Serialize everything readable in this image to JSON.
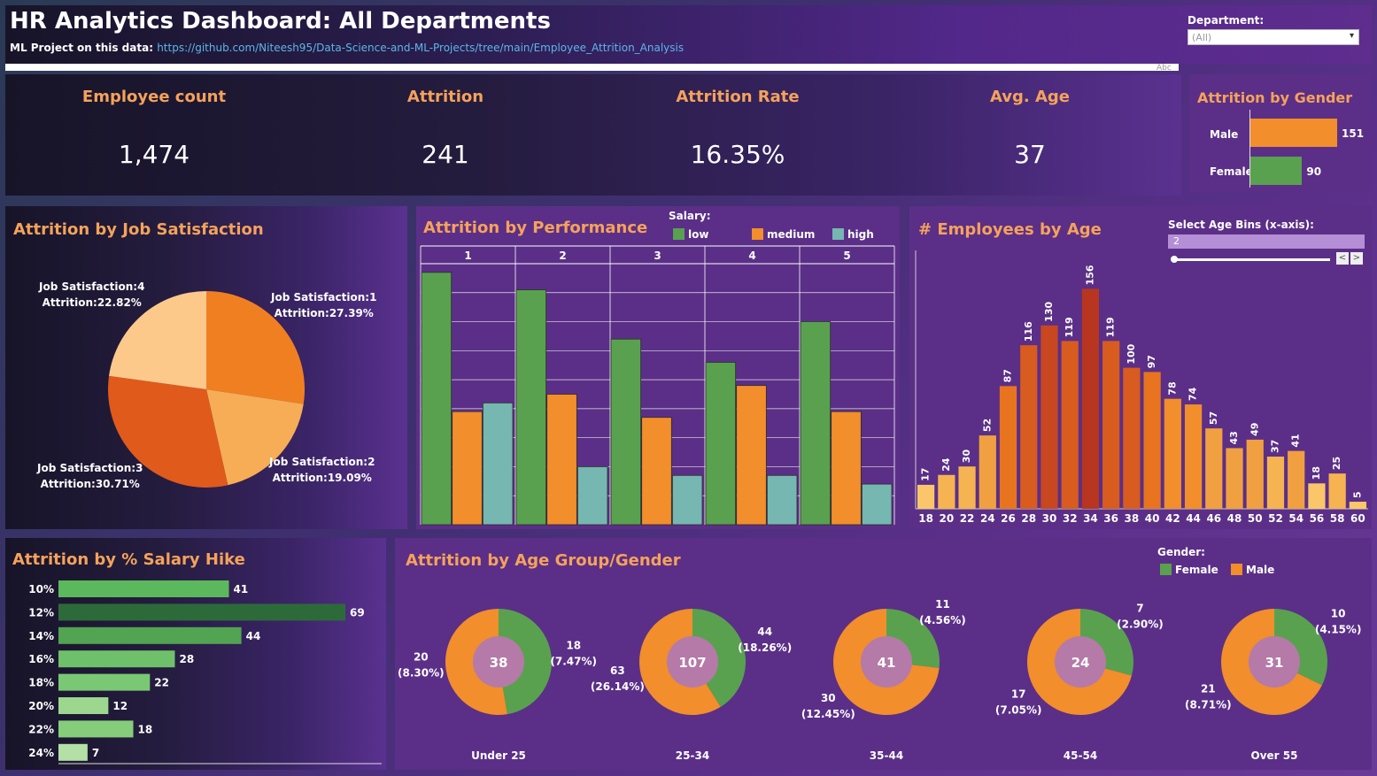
{
  "header": {
    "title": "HR Analytics Dashboard: All Departments",
    "ml_label": "ML Project on this data:",
    "ml_link": "https://github.com/Niteesh95/Data-Science-and-ML-Projects/tree/main/Employee_Attrition_Analysis",
    "department_label": "Department:",
    "department_value": "(All)",
    "abc": "Abc"
  },
  "kpis": {
    "employee_count_label": "Employee count",
    "employee_count": "1,474",
    "attrition_label": "Attrition",
    "attrition": "241",
    "attrition_rate_label": "Attrition Rate",
    "attrition_rate": "16.35%",
    "avg_age_label": "Avg. Age",
    "avg_age": "37"
  },
  "gender": {
    "title": "Attrition by Gender",
    "male_label": "Male",
    "male_value": "151",
    "female_label": "Female",
    "female_value": "90",
    "colors": {
      "male": "#f28e2b",
      "female": "#59a14f"
    }
  },
  "job_satisfaction": {
    "title": "Attrition by Job Satisfaction",
    "slices": [
      {
        "name": "Job Satisfaction:1",
        "attr": "Attrition:27.39%",
        "pct": 27.39,
        "color": "#f07f22"
      },
      {
        "name": "Job Satisfaction:2",
        "attr": "Attrition:19.09%",
        "pct": 19.09,
        "color": "#f6ad55"
      },
      {
        "name": "Job Satisfaction:3",
        "attr": "Attrition:30.71%",
        "pct": 30.71,
        "color": "#e05a1c"
      },
      {
        "name": "Job Satisfaction:4",
        "attr": "Attrition:22.82%",
        "pct": 22.82,
        "color": "#fdc98b"
      }
    ]
  },
  "performance": {
    "title": "Attrition by Performance",
    "legend_title": "Salary:",
    "legend": [
      {
        "name": "low",
        "color": "#59a14f"
      },
      {
        "name": "medium",
        "color": "#f28e2b"
      },
      {
        "name": "high",
        "color": "#76b7b2"
      }
    ],
    "columns": [
      "1",
      "2",
      "3",
      "4",
      "5"
    ]
  },
  "age": {
    "title": "# Employees by Age",
    "bins_label": "Select Age Bins (x-axis):",
    "bins_value": "2",
    "prev": "<",
    "next": ">",
    "ages": [
      "18",
      "20",
      "22",
      "24",
      "26",
      "28",
      "30",
      "32",
      "34",
      "36",
      "38",
      "40",
      "42",
      "44",
      "46",
      "48",
      "50",
      "52",
      "54",
      "56",
      "58",
      "60"
    ],
    "values": [
      17,
      24,
      30,
      52,
      87,
      116,
      130,
      119,
      156,
      119,
      100,
      97,
      78,
      74,
      57,
      43,
      49,
      37,
      41,
      18,
      25,
      5
    ]
  },
  "salary_hike": {
    "title": "Attrition by % Salary Hike",
    "rows": [
      {
        "label": "10%",
        "value": 41,
        "color": "#5cb85c"
      },
      {
        "label": "12%",
        "value": 69,
        "color": "#2d6a3a"
      },
      {
        "label": "14%",
        "value": 44,
        "color": "#52a352"
      },
      {
        "label": "16%",
        "value": 28,
        "color": "#6fc06a"
      },
      {
        "label": "18%",
        "value": 22,
        "color": "#7ac874"
      },
      {
        "label": "20%",
        "value": 12,
        "color": "#9cd68f"
      },
      {
        "label": "22%",
        "value": 18,
        "color": "#86cd7b"
      },
      {
        "label": "24%",
        "value": 7,
        "color": "#b3e0a6"
      }
    ]
  },
  "age_group": {
    "title": "Attrition by Age Group/Gender",
    "legend_title": "Gender:",
    "legend_female": "Female",
    "legend_male": "Male",
    "groups": [
      {
        "name": "Under 25",
        "total": "38",
        "female": 18,
        "male": 20,
        "female_label": "18",
        "female_pct": "(7.47%)",
        "male_label": "20",
        "male_pct": "(8.30%)"
      },
      {
        "name": "25-34",
        "total": "107",
        "female": 44,
        "male": 63,
        "female_label": "44",
        "female_pct": "(18.26%)",
        "male_label": "63",
        "male_pct": "(26.14%)"
      },
      {
        "name": "35-44",
        "total": "41",
        "female": 11,
        "male": 30,
        "female_label": "11",
        "female_pct": "(4.56%)",
        "male_label": "30",
        "male_pct": "(12.45%)"
      },
      {
        "name": "45-54",
        "total": "24",
        "female": 7,
        "male": 17,
        "female_label": "7",
        "female_pct": "(2.90%)",
        "male_label": "17",
        "male_pct": "(7.05%)"
      },
      {
        "name": "Over 55",
        "total": "31",
        "female": 10,
        "male": 21,
        "female_label": "10",
        "female_pct": "(4.15%)",
        "male_label": "21",
        "male_pct": "(8.71%)"
      }
    ]
  },
  "chart_data": [
    {
      "type": "bar",
      "title": "Attrition by Gender",
      "categories": [
        "Male",
        "Female"
      ],
      "values": [
        151,
        90
      ]
    },
    {
      "type": "pie",
      "title": "Attrition by Job Satisfaction",
      "categories": [
        "Job Satisfaction:1",
        "Job Satisfaction:2",
        "Job Satisfaction:3",
        "Job Satisfaction:4"
      ],
      "values": [
        27.39,
        19.09,
        30.71,
        22.82
      ]
    },
    {
      "type": "bar",
      "title": "Attrition by Performance",
      "categories": [
        "1",
        "2",
        "3",
        "4",
        "5"
      ],
      "series": [
        {
          "name": "low",
          "values": [
            87,
            81,
            64,
            56,
            70
          ]
        },
        {
          "name": "medium",
          "values": [
            39,
            45,
            37,
            48,
            39
          ]
        },
        {
          "name": "high",
          "values": [
            42,
            20,
            17,
            17,
            14
          ]
        }
      ]
    },
    {
      "type": "bar",
      "title": "# Employees by Age",
      "categories": [
        "18",
        "20",
        "22",
        "24",
        "26",
        "28",
        "30",
        "32",
        "34",
        "36",
        "38",
        "40",
        "42",
        "44",
        "46",
        "48",
        "50",
        "52",
        "54",
        "56",
        "58",
        "60"
      ],
      "values": [
        17,
        24,
        30,
        52,
        87,
        116,
        130,
        119,
        156,
        119,
        100,
        97,
        78,
        74,
        57,
        43,
        49,
        37,
        41,
        18,
        25,
        5
      ]
    },
    {
      "type": "bar",
      "title": "Attrition by % Salary Hike",
      "categories": [
        "10%",
        "12%",
        "14%",
        "16%",
        "18%",
        "20%",
        "22%",
        "24%"
      ],
      "values": [
        41,
        69,
        44,
        28,
        22,
        12,
        18,
        7
      ]
    },
    {
      "type": "pie",
      "title": "Attrition by Age Group/Gender",
      "categories": [
        "Under 25",
        "25-34",
        "35-44",
        "45-54",
        "Over 55"
      ],
      "series": [
        {
          "name": "Female",
          "values": [
            18,
            44,
            11,
            7,
            10
          ]
        },
        {
          "name": "Male",
          "values": [
            20,
            63,
            30,
            17,
            21
          ]
        }
      ]
    }
  ]
}
